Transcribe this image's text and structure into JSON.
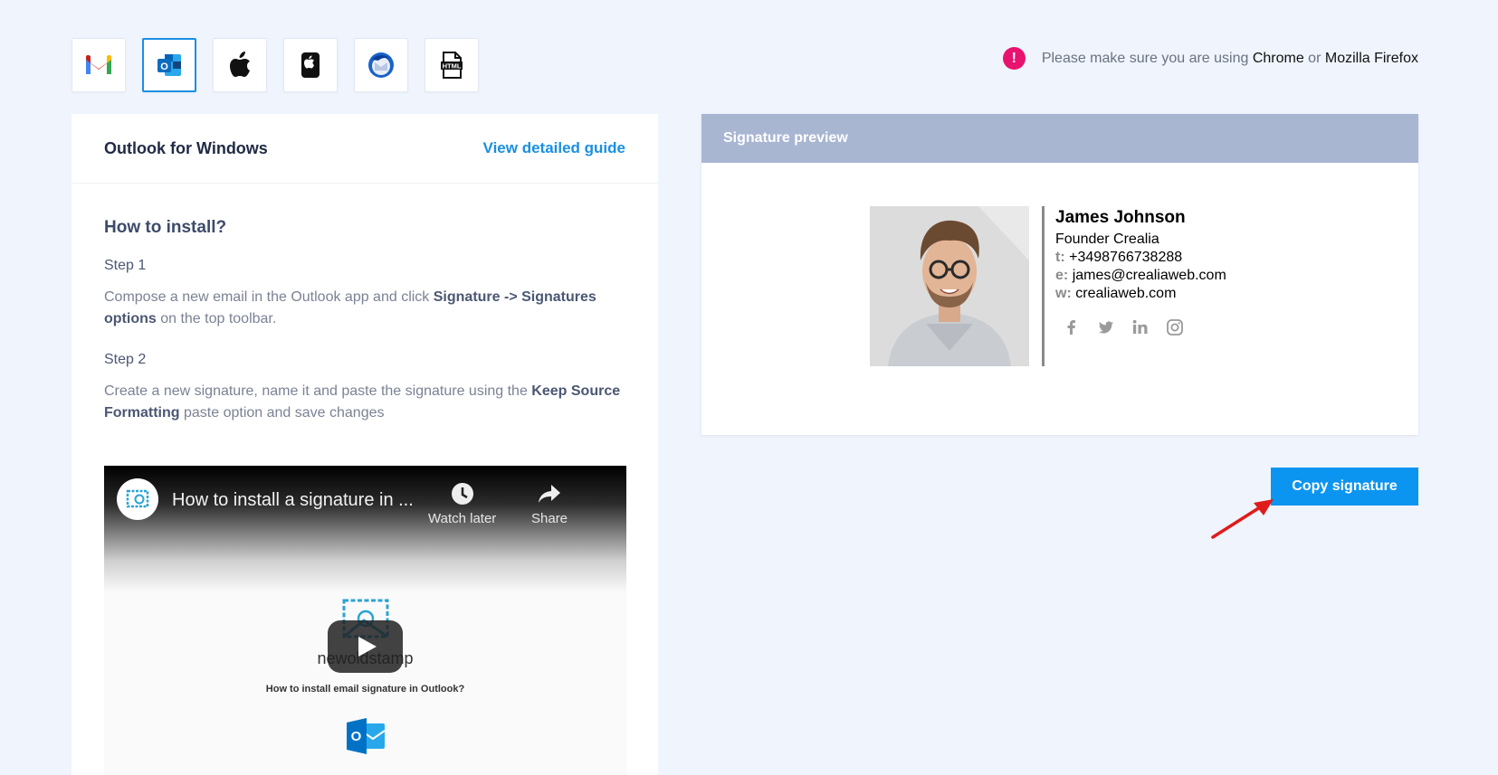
{
  "clients": [
    {
      "name": "gmail-icon",
      "active": false
    },
    {
      "name": "outlook-icon",
      "active": true
    },
    {
      "name": "apple-mail-icon",
      "active": false
    },
    {
      "name": "iphone-icon",
      "active": false
    },
    {
      "name": "thunderbird-icon",
      "active": false
    },
    {
      "name": "html-file-icon",
      "active": false
    }
  ],
  "browser_note": {
    "prefix": "Please make sure you are using ",
    "browser1": "Chrome",
    "or": " or ",
    "browser2": "Mozilla Firefox",
    "icon": "!"
  },
  "guide": {
    "title": "Outlook for Windows",
    "link": "View detailed guide",
    "heading": "How to install?",
    "step1_title": "Step 1",
    "step1_a": "Compose a new email in the Outlook app and click ",
    "step1_b": "Signature -> Signatures options",
    "step1_c": " on the top toolbar.",
    "step2_title": "Step 2",
    "step2_a": "Create a new signature, name it and paste the signature using the ",
    "step2_b": "Keep Source Formatting",
    "step2_c": " paste option and save changes"
  },
  "video": {
    "title": "How to install a signature in ...",
    "watch_later": "Watch later",
    "share": "Share",
    "brand": "newoldstamp",
    "caption": "How to install email signature in Outlook?"
  },
  "preview": {
    "header": "Signature preview",
    "name": "James Johnson",
    "role": "Founder Crealia",
    "phone_label": "t:",
    "phone": "+3498766738288",
    "email_label": "e:",
    "email": "james@crealiaweb.com",
    "web_label": "w:",
    "web": "crealiaweb.com"
  },
  "copy_button": "Copy signature",
  "colors": {
    "accent": "#0b95f0",
    "preview_header": "#a8b6d2",
    "warning": "#e8136e",
    "background": "#eff4fd"
  }
}
